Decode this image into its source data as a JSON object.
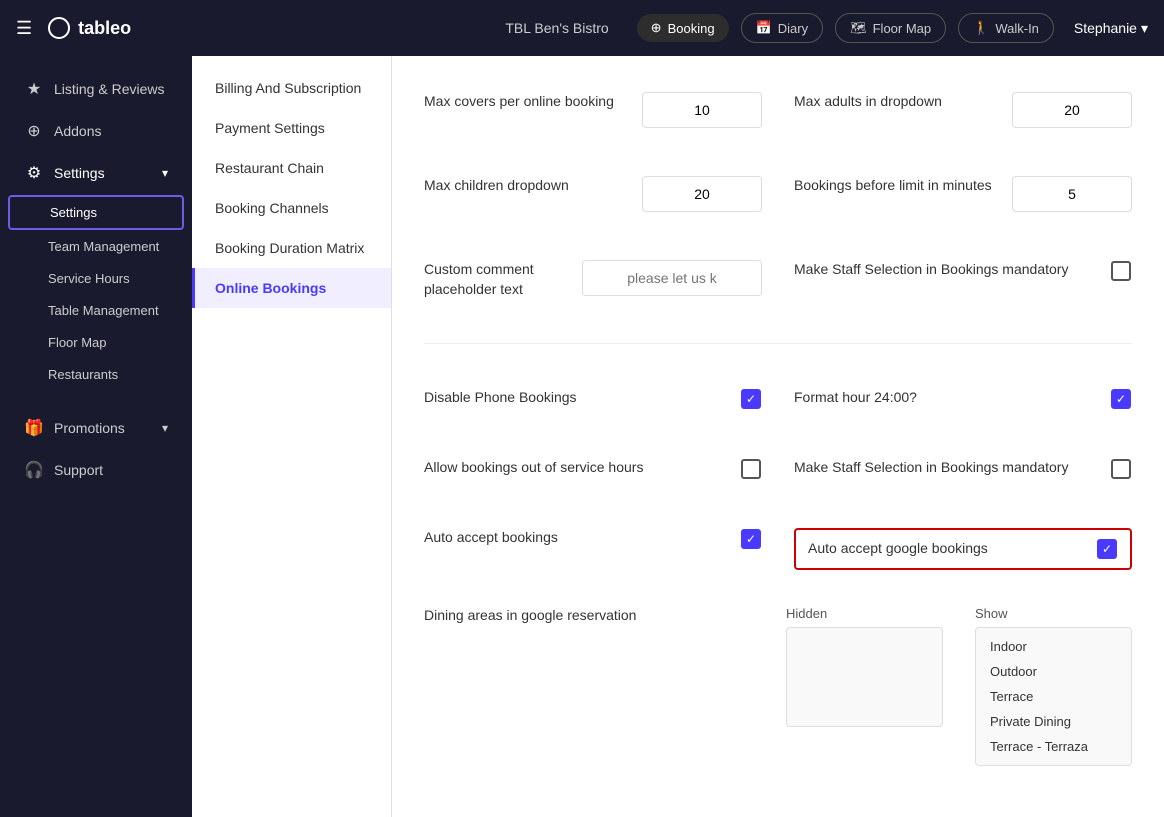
{
  "topNav": {
    "hamburger": "☰",
    "logo": "tableo",
    "logoCircle": "○",
    "venue": "TBL Ben's Bistro",
    "buttons": {
      "booking": "Booking",
      "diary": "Diary",
      "floorMap": "Floor Map",
      "walkIn": "Walk-In"
    },
    "user": "Stephanie"
  },
  "sidebar": {
    "items": [
      {
        "id": "listing",
        "label": "Listing & Reviews",
        "icon": "★"
      },
      {
        "id": "addons",
        "label": "Addons",
        "icon": "⊕"
      },
      {
        "id": "settings",
        "label": "Settings",
        "icon": "⚙",
        "active": true,
        "hasArrow": true
      }
    ],
    "subItems": [
      {
        "id": "settings-sub",
        "label": "Settings",
        "active": true
      },
      {
        "id": "team-management",
        "label": "Team Management"
      },
      {
        "id": "service-hours",
        "label": "Service Hours"
      },
      {
        "id": "table-management",
        "label": "Table Management"
      },
      {
        "id": "floor-map",
        "label": "Floor Map"
      },
      {
        "id": "restaurants",
        "label": "Restaurants"
      }
    ],
    "bottomItems": [
      {
        "id": "promotions",
        "label": "Promotions",
        "icon": "🎁",
        "hasArrow": true
      },
      {
        "id": "support",
        "label": "Support",
        "icon": "🎧"
      }
    ]
  },
  "midNav": {
    "items": [
      {
        "id": "billing",
        "label": "Billing And Subscription"
      },
      {
        "id": "payment",
        "label": "Payment Settings"
      },
      {
        "id": "restaurant-chain",
        "label": "Restaurant Chain"
      },
      {
        "id": "booking-channels",
        "label": "Booking Channels"
      },
      {
        "id": "booking-duration",
        "label": "Booking Duration Matrix"
      },
      {
        "id": "online-bookings",
        "label": "Online Bookings",
        "active": true
      }
    ]
  },
  "settings": {
    "maxCoversLabel": "Max covers per online booking",
    "maxCoversValue": "10",
    "maxAdultsLabel": "Max adults in dropdown",
    "maxAdultsValue": "20",
    "maxChildrenLabel": "Max children dropdown",
    "maxChildrenValue": "20",
    "bookingsBeforeLabel": "Bookings before limit in minutes",
    "bookingsBeforeValue": "5",
    "customCommentLabel": "Custom comment placeholder text",
    "customCommentPlaceholder": "please let us k",
    "makeStaffLabel": "Make Staff Selection in Bookings mandatory",
    "makeStaffChecked": false,
    "disablePhoneLabel": "Disable Phone Bookings",
    "disablePhoneChecked": true,
    "formatHourLabel": "Format hour 24:00?",
    "formatHourChecked": true,
    "allowBookingsLabel": "Allow bookings out of service hours",
    "allowBookingsChecked": false,
    "makeStaff2Label": "Make Staff Selection in Bookings mandatory",
    "makeStaff2Checked": false,
    "autoAcceptLabel": "Auto accept bookings",
    "autoAcceptChecked": true,
    "autoAcceptGoogleLabel": "Auto accept google bookings",
    "autoAcceptGoogleChecked": true,
    "diningAreasLabel": "Dining areas in google reservation",
    "hiddenLabel": "Hidden",
    "showLabel": "Show",
    "showItems": [
      "Indoor",
      "Outdoor",
      "Terrace",
      "Private Dining",
      "Terrace - Terraza"
    ]
  }
}
